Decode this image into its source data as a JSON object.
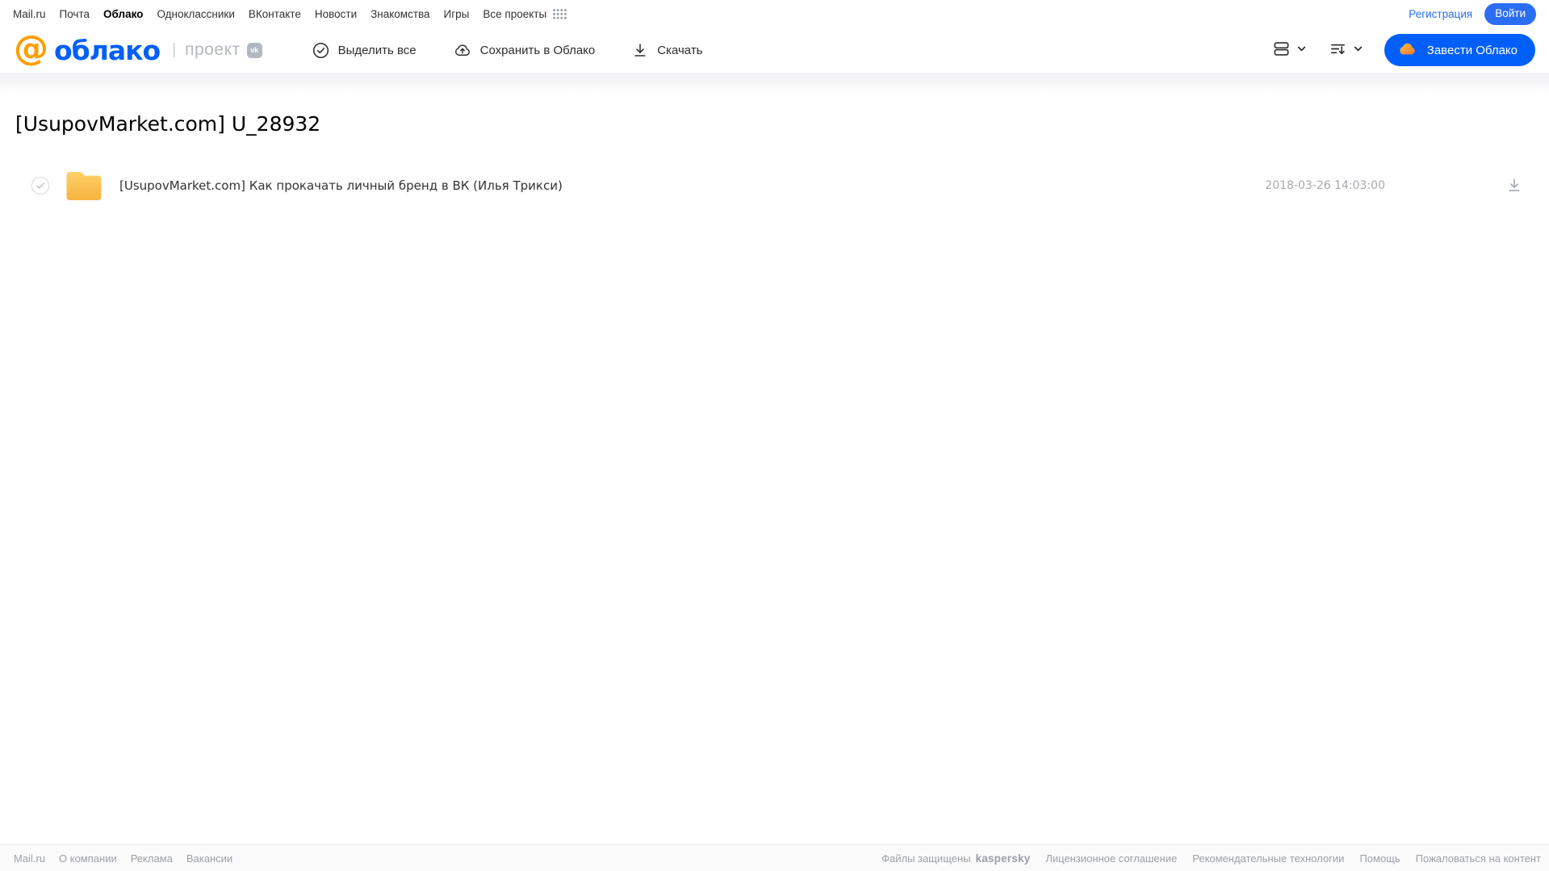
{
  "topnav": {
    "items": [
      "Mail.ru",
      "Почта",
      "Облако",
      "Одноклассники",
      "ВКонтакте",
      "Новости",
      "Знакомства",
      "Игры",
      "Все проекты"
    ],
    "active_item": "Облако",
    "register_label": "Регистрация",
    "login_label": "Войти"
  },
  "header": {
    "logo_at": "@",
    "logo_text": "облако",
    "project_label": "проект",
    "vk_badge": "vk",
    "toolbar": {
      "select_all_label": "Выделить все",
      "save_to_cloud_label": "Сохранить в Облако",
      "download_label": "Скачать"
    },
    "create_cloud_label": "Завести Облако"
  },
  "page": {
    "title": "[UsupovMarket.com] U_28932"
  },
  "files": [
    {
      "type": "folder",
      "name": "[UsupovMarket.com] Как прокачать личный бренд в ВК (Илья Трикси)",
      "modified": "2018-03-26 14:03:00"
    }
  ],
  "footer": {
    "links_left": [
      "Mail.ru",
      "О компании",
      "Реклама",
      "Вакансии"
    ],
    "protected_by": "Файлы защищены",
    "kaspersky": "kaspersky",
    "links_right": [
      "Лицензионное соглашение",
      "Рекомендательные технологии",
      "Помощь",
      "Пожаловаться на контент"
    ]
  },
  "colors": {
    "brand_blue": "#005ff9",
    "brand_orange": "#ff9e00",
    "kaspersky_green": "#00a88e",
    "folder_yellow": "#fbc14f"
  },
  "icons": {
    "all_projects": "grid-dots",
    "select_all": "check-circle",
    "save_to_cloud": "cloud-upload",
    "download": "arrow-down-underline",
    "view_mode": "list-rows",
    "sort": "sort-lines-down-arrow",
    "create_cloud": "cloud-solid-orange",
    "file": "folder",
    "row_checkbox": "check-circle"
  }
}
